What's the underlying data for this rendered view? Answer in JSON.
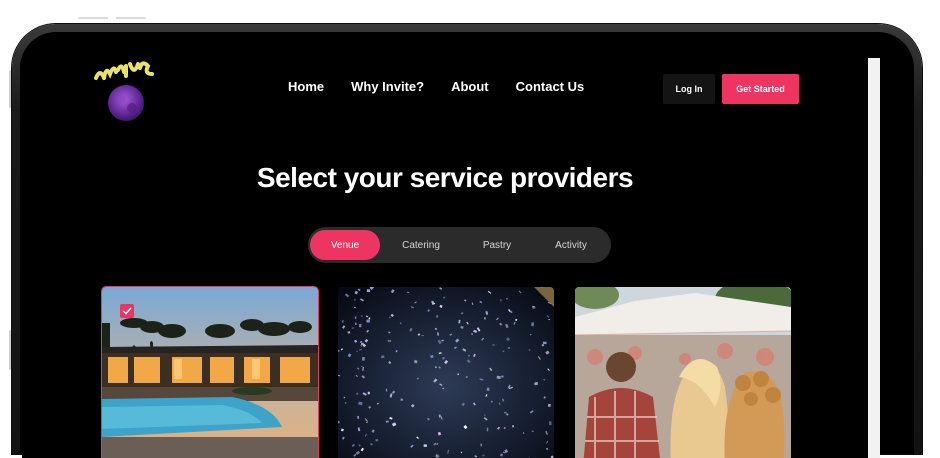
{
  "brand": {
    "logo_text": "Invite"
  },
  "nav": {
    "links": [
      "Home",
      "Why Invite?",
      "About",
      "Contact Us"
    ],
    "login_label": "Log In",
    "get_started_label": "Get Started"
  },
  "headline": "Select your service providers",
  "tabs": [
    {
      "label": "Venue",
      "active": true
    },
    {
      "label": "Catering",
      "active": false
    },
    {
      "label": "Pastry",
      "active": false
    },
    {
      "label": "Activity",
      "active": false
    }
  ],
  "cards": [
    {
      "subject": "venue-house-pool",
      "selected": true
    },
    {
      "subject": "confetti",
      "selected": false
    },
    {
      "subject": "outdoor-festival",
      "selected": false
    }
  ],
  "colors": {
    "accent": "#ee3561",
    "background": "#000000",
    "logo": "#e9e36a"
  },
  "icons": [
    "logo-icon",
    "checkmark-icon"
  ]
}
